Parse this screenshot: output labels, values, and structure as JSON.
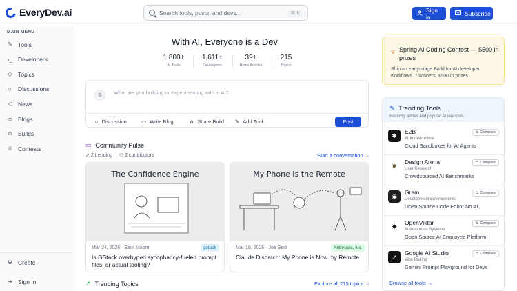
{
  "header": {
    "logo_text": "EveryDev.ai",
    "search_placeholder": "Search tools, posts, and devs...",
    "search_shortcut": "⌘ K",
    "signin_label": "Sign in",
    "subscribe_label": "Subscribe"
  },
  "sidebar": {
    "menu_title": "MAIN MENU",
    "items": [
      {
        "label": "Tools",
        "icon": "wrench-icon"
      },
      {
        "label": "Developers",
        "icon": "terminal-icon"
      },
      {
        "label": "Topics",
        "icon": "tag-icon"
      },
      {
        "label": "Discussions",
        "icon": "chat-icon"
      },
      {
        "label": "News",
        "icon": "megaphone-icon"
      },
      {
        "label": "Blogs",
        "icon": "book-icon"
      },
      {
        "label": "Builds",
        "icon": "network-icon"
      },
      {
        "label": "Contests",
        "icon": "trophy-icon"
      }
    ],
    "create_label": "Create",
    "signin_label": "Sign In"
  },
  "hero": {
    "title": "With AI, Everyone is a Dev",
    "stats": [
      {
        "value": "1,800+",
        "label": "AI Tools"
      },
      {
        "value": "1,611+",
        "label": "Developers"
      },
      {
        "value": "39+",
        "label": "News Articles"
      },
      {
        "value": "215",
        "label": "Topics"
      }
    ]
  },
  "composer": {
    "placeholder": "What are you building or experimenting with in AI?",
    "actions": [
      {
        "label": "Discussion",
        "icon": "chat-icon"
      },
      {
        "label": "Write Blog",
        "icon": "book-icon"
      },
      {
        "label": "Share Build",
        "icon": "network-icon"
      },
      {
        "label": "Add Tool",
        "icon": "wrench-icon"
      }
    ],
    "post_label": "Post"
  },
  "pulse": {
    "title": "Community Pulse",
    "trending": "2 trending",
    "contributors": "2 contributors",
    "link": "Start a conversation →",
    "cards": [
      {
        "image_title": "The Confidence Engine",
        "date": "Mar 24, 2026",
        "author": "Sam Moore",
        "tag": "gstack",
        "title": "Is GStack overhyped sycophancy-fueled prompt files, or actual tooling?"
      },
      {
        "image_title": "My Phone Is the Remote",
        "date": "Mar 18, 2026",
        "author": "Joe Seifi",
        "tag": "Anthropic, Inc.",
        "title": "Claude Dispatch: My Phone is Now my Remote"
      }
    ]
  },
  "trending_topics": {
    "title": "Trending Topics",
    "link": "Explore all 215 topics →"
  },
  "contest": {
    "title": "Spring AI Coding Contest — $500 in prizes",
    "text": "Ship an early-stage Build for AI developer workflows. 7 winners, $500 in prizes."
  },
  "trending_tools": {
    "title": "Trending Tools",
    "subtitle": "Recently added and popular AI dev tools",
    "compare_label": "Compare",
    "browse_link": "Browse all tools →",
    "tools": [
      {
        "name": "E2B",
        "category": "AI Infrastructure",
        "desc": "Cloud Sandboxes for AI Agents",
        "color": "#111111"
      },
      {
        "name": "Design Arena",
        "category": "User Research",
        "desc": "Crowdsourced AI Benchmarks",
        "color": "#ffffff"
      },
      {
        "name": "Gram",
        "category": "Development Environments",
        "desc": "Open Source Code Editor No AI",
        "color": "#1f1f1f"
      },
      {
        "name": "OpenViktor",
        "category": "Autonomous Systems",
        "desc": "Open Source AI Employee Platform",
        "color": "#ffffff"
      },
      {
        "name": "Google AI Studio",
        "category": "Vibe Coding",
        "desc": "Gemini Prompt Playground for Devs",
        "color": "#111111"
      }
    ]
  },
  "colors": {
    "accent": "#1d4ed8",
    "contest_bg": "#fef9e7",
    "tag_green_bg": "#dcfce7",
    "tag_green_text": "#166534"
  }
}
